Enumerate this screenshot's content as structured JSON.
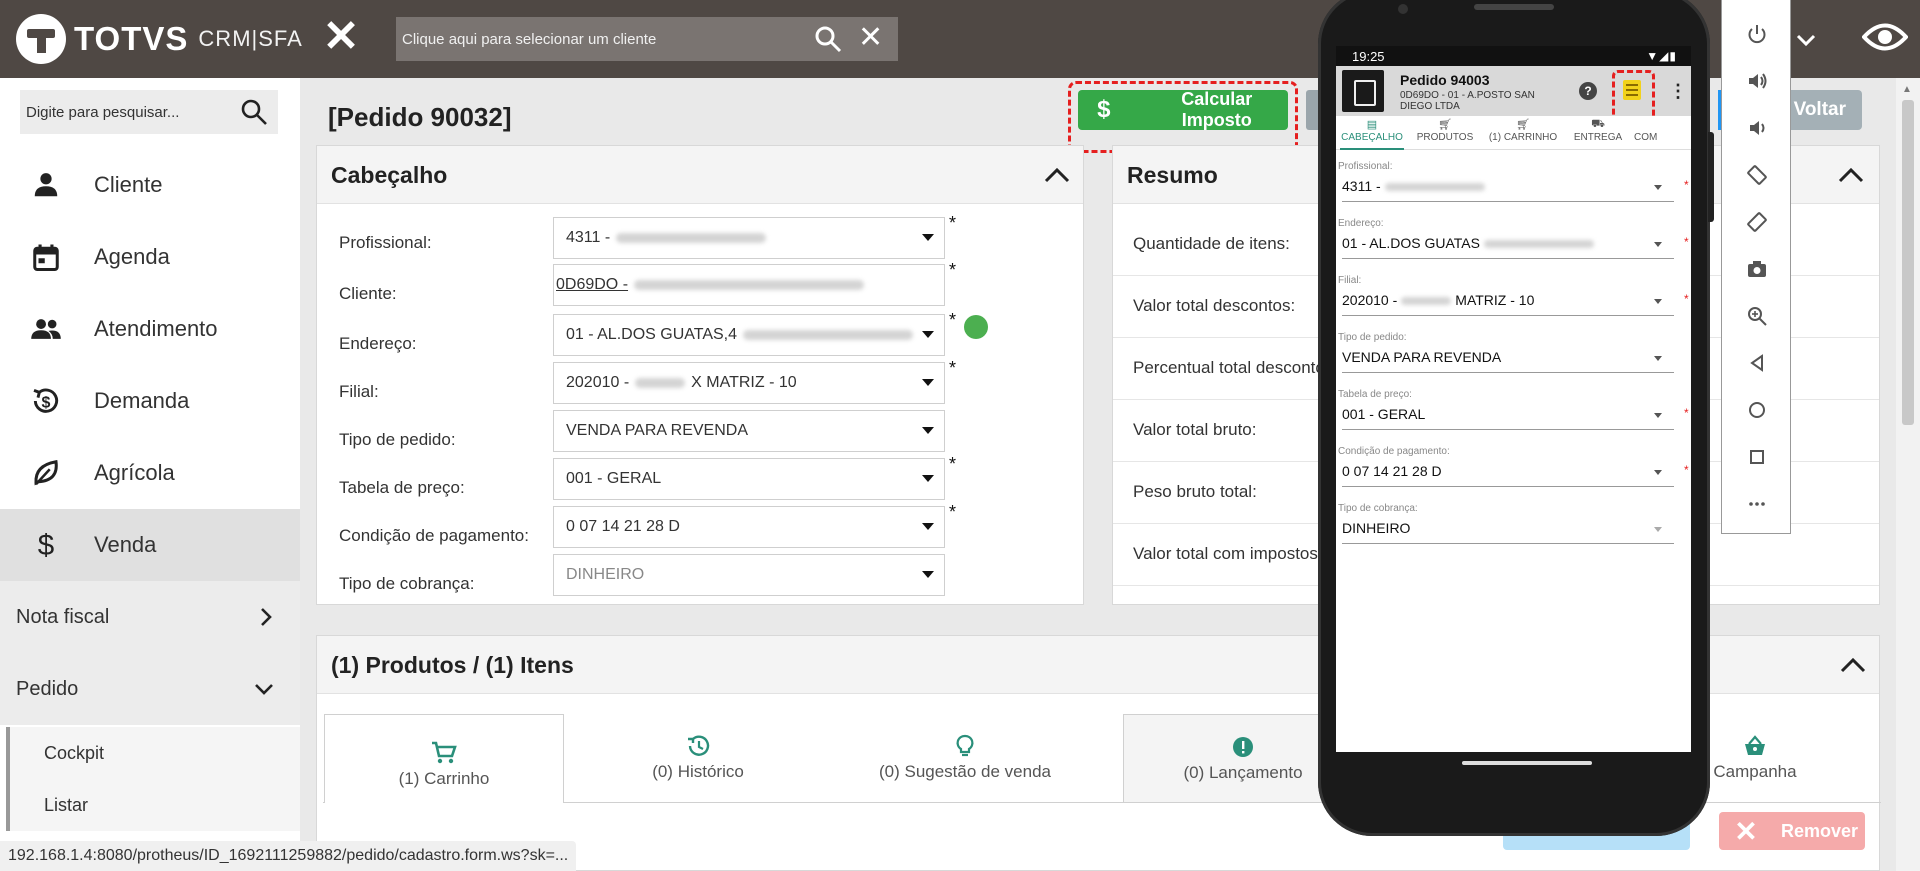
{
  "header": {
    "brand": "TOTVS",
    "product": "CRM|SFA",
    "client_search_placeholder": "Clique aqui para selecionar um cliente"
  },
  "sidebar": {
    "search_placeholder": "Digite para pesquisar...",
    "items": [
      {
        "label": "Cliente",
        "icon": "person-icon"
      },
      {
        "label": "Agenda",
        "icon": "calendar-icon"
      },
      {
        "label": "Atendimento",
        "icon": "group-icon"
      },
      {
        "label": "Demanda",
        "icon": "demand-icon"
      },
      {
        "label": "Agrícola",
        "icon": "leaf-icon"
      },
      {
        "label": "Venda",
        "icon": "dollar-icon"
      }
    ],
    "groups": [
      {
        "label": "Nota fiscal"
      },
      {
        "label": "Pedido"
      }
    ],
    "subitems": [
      {
        "label": "Cockpit"
      },
      {
        "label": "Listar"
      }
    ],
    "status_url": "192.168.1.4:8080/protheus/ID_1692111259882/pedido/cadastro.form.ws?sk=..."
  },
  "main": {
    "title": "[Pedido 90032]",
    "calc_button": "Calcular Imposto",
    "back_button": "Voltar",
    "header_card": {
      "title": "Cabeçalho",
      "fields": [
        {
          "label": "Profissional:",
          "value": "4311 -",
          "required": "*"
        },
        {
          "label": "Cliente:",
          "value": "0D69DO -",
          "required": "*"
        },
        {
          "label": "Endereço:",
          "value": "01 - AL.DOS GUATAS,4",
          "required": "*"
        },
        {
          "label": "Filial:",
          "value": "202010 -",
          "value2": "X MATRIZ - 10",
          "required": "*"
        },
        {
          "label": "Tipo de pedido:",
          "value": "VENDA PARA REVENDA"
        },
        {
          "label": "Tabela de preço:",
          "value": "001 - GERAL",
          "required": "*"
        },
        {
          "label": "Condição de pagamento:",
          "value": "0 07 14 21 28 D",
          "required": "*"
        },
        {
          "label": "Tipo de cobrança:",
          "value": "DINHEIRO"
        }
      ]
    },
    "summary_card": {
      "title": "Resumo",
      "rows": [
        "Quantidade de itens:",
        "Valor total descontos:",
        "Percentual total descontos",
        "Valor total bruto:",
        "Peso bruto total:",
        "Valor total com impostos"
      ]
    },
    "products_card": {
      "title": "(1) Produtos / (1) Itens",
      "tabs": [
        {
          "label": "(1) Carrinho"
        },
        {
          "label": "(0) Histórico"
        },
        {
          "label": "(0) Sugestão de venda"
        },
        {
          "label": "(0) Lançamento"
        },
        {
          "label": "Campanha"
        }
      ],
      "remove_button": "Remover"
    }
  },
  "phone": {
    "time": "19:25",
    "order_title": "Pedido 94003",
    "order_sub": "0D69DO - 01 - A.POSTO SAN DIEGO LTDA",
    "help": "?",
    "tabs": [
      "CABEÇALHO",
      "PRODUTOS",
      "(1) CARRINHO",
      "ENTREGA",
      "COM"
    ],
    "fields": [
      {
        "label": "Profissional:",
        "value": "4311 -",
        "required": "*"
      },
      {
        "label": "Endereço:",
        "value": "01 - AL.DOS GUATAS",
        "required": "*"
      },
      {
        "label": "Filial:",
        "value": "202010 -",
        "value2": "MATRIZ - 10",
        "required": "*"
      },
      {
        "label": "Tipo de pedido:",
        "value": "VENDA PARA REVENDA"
      },
      {
        "label": "Tabela de preço:",
        "value": "001 - GERAL",
        "required": "*"
      },
      {
        "label": "Condição de pagamento:",
        "value": "0 07 14 21 28 D",
        "required": "*"
      },
      {
        "label": "Tipo de cobrança:",
        "value": "DINHEIRO"
      }
    ]
  },
  "emulator": {
    "buttons": [
      "power-icon",
      "volume-up-icon",
      "volume-down-icon",
      "rotate-left-icon",
      "rotate-right-icon",
      "camera-icon",
      "zoom-icon",
      "back-icon",
      "home-icon",
      "overview-icon",
      "more-icon"
    ]
  },
  "colors": {
    "header_bg": "#4f4844",
    "calc_green": "#35a848",
    "highlight_red": "#e51f1f",
    "accent_teal": "#2a8f7a",
    "status_green": "#4caf50"
  }
}
